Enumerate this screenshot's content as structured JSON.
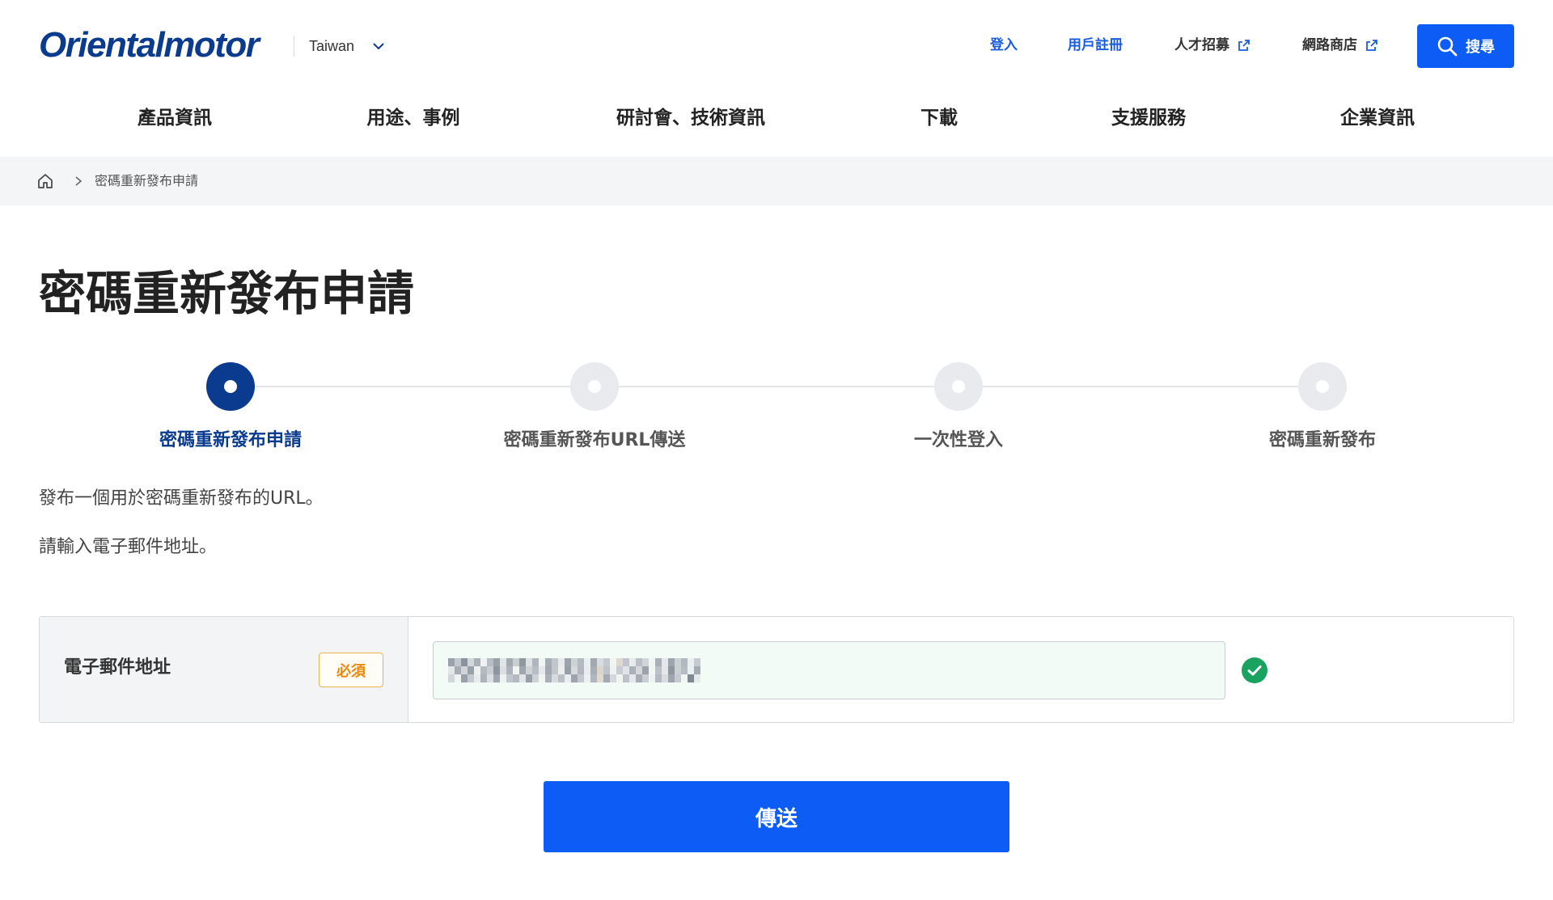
{
  "header": {
    "logo_text": "Orientalmotor",
    "region_label": "Taiwan",
    "links": [
      {
        "label": "登入"
      },
      {
        "label": "用戶註冊"
      },
      {
        "label": "人才招募"
      },
      {
        "label": "網路商店"
      }
    ],
    "search_label": "搜尋"
  },
  "nav": {
    "items": [
      {
        "label": "產品資訊"
      },
      {
        "label": "用途、事例"
      },
      {
        "label": "研討會、技術資訊"
      },
      {
        "label": "下載"
      },
      {
        "label": "支援服務"
      },
      {
        "label": "企業資訊"
      }
    ]
  },
  "breadcrumb": {
    "current": "密碼重新發布申請"
  },
  "page": {
    "title": "密碼重新發布申請",
    "description": "發布一個用於密碼重新發布的URL。",
    "instruction": "請輸入電子郵件地址。"
  },
  "steps": {
    "current_index": 0,
    "items": [
      {
        "label": "密碼重新發布申請"
      },
      {
        "label": "密碼重新發布URL傳送"
      },
      {
        "label": "一次性登入"
      },
      {
        "label": "密碼重新發布"
      }
    ]
  },
  "form": {
    "email_label": "電子郵件地址",
    "required_badge": "必須",
    "email_value": "",
    "email_valid": true
  },
  "submit_label": "傳送",
  "colors": {
    "brand_navy": "#0a3b8f",
    "link_blue": "#1a5ce0",
    "primary_button": "#0c5cf5",
    "required_orange": "#e8890c",
    "valid_green": "#1aa360"
  }
}
